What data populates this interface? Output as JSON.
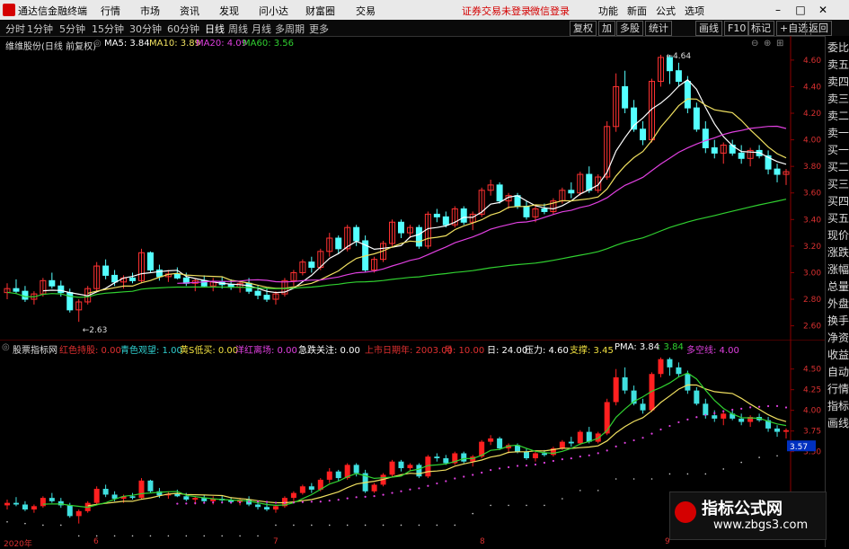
{
  "titlebar": {
    "app_name": "通达信金融终端",
    "menus": [
      "行情",
      "市场",
      "资讯",
      "发现",
      "问小达",
      "财富圈",
      "交易"
    ],
    "login_notice": "证券交易未登录",
    "login_link": "微信登录",
    "tools": [
      "功能",
      "新面",
      "公式",
      "选项"
    ]
  },
  "periods": [
    "分时",
    "1分钟",
    "5分钟",
    "15分钟",
    "30分钟",
    "60分钟",
    "日线",
    "周线",
    "月线",
    "多周期",
    "更多"
  ],
  "active_period": "日线",
  "toolbar_right": [
    "复权",
    "加",
    "多股",
    "统计",
    "画线",
    "F10",
    "标记",
    "+自选",
    "返回"
  ],
  "main_chart": {
    "title": "维维股份(日线 前复权)",
    "ma": [
      {
        "label": "MA5: 3.84",
        "color": "#ffffff"
      },
      {
        "label": "MA10: 3.89",
        "color": "#f0e060"
      },
      {
        "label": "MA20: 4.09",
        "color": "#e040e0"
      },
      {
        "label": "MA60: 3.56",
        "color": "#30d030"
      }
    ],
    "y_ticks": [
      "4.60",
      "4.40",
      "4.20",
      "4.00",
      "3.80",
      "3.60",
      "3.40",
      "3.20",
      "3.00",
      "2.80",
      "2.60"
    ],
    "annotations": {
      "high": "4.64",
      "low": "2.63"
    }
  },
  "lower_chart": {
    "title": "股票指标网",
    "items": [
      {
        "label": "红色持股: 0.00",
        "color": "#e03030"
      },
      {
        "label": "青色观望: 1.00",
        "color": "#30d0d0"
      },
      {
        "label": "黄S低买: 0.00",
        "color": "#f0e040"
      },
      {
        "label": "洋红离场: 0.00",
        "color": "#e040e0"
      },
      {
        "label": "急跌关注: 0.00",
        "color": "#ffffff"
      },
      {
        "label": "上市日期年: 2003.00",
        "color": "#e03030"
      },
      {
        "label": "月: 10.00",
        "color": "#e03030"
      },
      {
        "label": "日: 24.00",
        "color": "#ffffff"
      },
      {
        "label": "压力: 4.60",
        "color": "#ffffff"
      },
      {
        "label": "支撑: 3.45",
        "color": "#f0e040"
      },
      {
        "label": "PMA: 3.84",
        "color": "#ffffff"
      },
      {
        "label": ": 3.84",
        "color": "#30d030"
      },
      {
        "label": "多空线: 4.00",
        "color": "#e040e0"
      }
    ],
    "y_ticks": [
      "4.50",
      "4.25",
      "4.00",
      "3.75",
      "3.50"
    ],
    "current_value": "3.57"
  },
  "x_axis": [
    "2020年",
    "6",
    "7",
    "8",
    "9"
  ],
  "right_panel": [
    "委比",
    "卖五",
    "卖四",
    "卖三",
    "卖二",
    "卖一",
    "买一",
    "买二",
    "买三",
    "买四",
    "买五",
    "现价",
    "涨跌",
    "涨幅",
    "总量",
    "外盘",
    "换手",
    "净资",
    "收益",
    "自动",
    "行情",
    "指标",
    "画线"
  ],
  "watermark": {
    "title": "指标公式网",
    "url": "www.zbgs3.com"
  },
  "colors": {
    "up": "#ff3232",
    "down": "#54ffff",
    "ma5": "#ffffff",
    "ma10": "#f0e060",
    "ma20": "#e040e0",
    "ma60": "#30d030"
  },
  "candles": [
    [
      2.85,
      2.92,
      2.8,
      2.88
    ],
    [
      2.88,
      2.95,
      2.84,
      2.86
    ],
    [
      2.86,
      2.9,
      2.78,
      2.8
    ],
    [
      2.8,
      2.86,
      2.76,
      2.84
    ],
    [
      2.84,
      2.96,
      2.82,
      2.94
    ],
    [
      2.94,
      3.0,
      2.88,
      2.9
    ],
    [
      2.9,
      2.94,
      2.82,
      2.85
    ],
    [
      2.85,
      2.88,
      2.7,
      2.72
    ],
    [
      2.72,
      2.8,
      2.63,
      2.78
    ],
    [
      2.78,
      2.9,
      2.76,
      2.88
    ],
    [
      2.88,
      3.08,
      2.86,
      3.05
    ],
    [
      3.05,
      3.1,
      2.95,
      2.98
    ],
    [
      2.98,
      3.02,
      2.9,
      2.93
    ],
    [
      2.93,
      2.98,
      2.88,
      2.96
    ],
    [
      2.96,
      3.0,
      2.92,
      2.94
    ],
    [
      2.94,
      3.18,
      2.92,
      3.15
    ],
    [
      3.15,
      3.16,
      3.0,
      3.02
    ],
    [
      3.02,
      3.06,
      2.94,
      2.97
    ],
    [
      2.97,
      3.02,
      2.93,
      2.99
    ],
    [
      2.99,
      3.04,
      2.95,
      2.96
    ],
    [
      2.96,
      3.0,
      2.9,
      2.92
    ],
    [
      2.92,
      2.96,
      2.86,
      2.94
    ],
    [
      2.94,
      2.98,
      2.89,
      2.9
    ],
    [
      2.9,
      2.96,
      2.86,
      2.93
    ],
    [
      2.93,
      2.97,
      2.88,
      2.91
    ],
    [
      2.91,
      2.95,
      2.87,
      2.89
    ],
    [
      2.89,
      2.94,
      2.85,
      2.92
    ],
    [
      2.92,
      2.96,
      2.84,
      2.86
    ],
    [
      2.86,
      2.9,
      2.8,
      2.83
    ],
    [
      2.83,
      2.88,
      2.78,
      2.8
    ],
    [
      2.8,
      2.86,
      2.76,
      2.84
    ],
    [
      2.84,
      2.96,
      2.82,
      2.94
    ],
    [
      2.94,
      3.02,
      2.9,
      3.0
    ],
    [
      3.0,
      3.1,
      2.98,
      3.08
    ],
    [
      3.08,
      3.12,
      3.0,
      3.04
    ],
    [
      3.04,
      3.18,
      3.02,
      3.16
    ],
    [
      3.16,
      3.3,
      3.12,
      3.26
    ],
    [
      3.26,
      3.28,
      3.14,
      3.18
    ],
    [
      3.18,
      3.36,
      3.16,
      3.34
    ],
    [
      3.34,
      3.36,
      3.2,
      3.24
    ],
    [
      3.24,
      3.28,
      3.0,
      3.02
    ],
    [
      3.02,
      3.12,
      3.0,
      3.1
    ],
    [
      3.1,
      3.24,
      3.08,
      3.22
    ],
    [
      3.22,
      3.4,
      3.2,
      3.38
    ],
    [
      3.38,
      3.4,
      3.26,
      3.3
    ],
    [
      3.3,
      3.36,
      3.26,
      3.34
    ],
    [
      3.34,
      3.36,
      3.18,
      3.2
    ],
    [
      3.2,
      3.46,
      3.18,
      3.44
    ],
    [
      3.44,
      3.48,
      3.38,
      3.42
    ],
    [
      3.42,
      3.46,
      3.34,
      3.36
    ],
    [
      3.36,
      3.5,
      3.34,
      3.48
    ],
    [
      3.48,
      3.5,
      3.36,
      3.38
    ],
    [
      3.38,
      3.46,
      3.32,
      3.44
    ],
    [
      3.44,
      3.64,
      3.42,
      3.62
    ],
    [
      3.62,
      3.7,
      3.58,
      3.66
    ],
    [
      3.66,
      3.68,
      3.52,
      3.54
    ],
    [
      3.54,
      3.6,
      3.48,
      3.58
    ],
    [
      3.58,
      3.6,
      3.48,
      3.5
    ],
    [
      3.5,
      3.54,
      3.4,
      3.42
    ],
    [
      3.42,
      3.5,
      3.38,
      3.48
    ],
    [
      3.48,
      3.52,
      3.44,
      3.46
    ],
    [
      3.46,
      3.56,
      3.44,
      3.54
    ],
    [
      3.54,
      3.64,
      3.52,
      3.62
    ],
    [
      3.62,
      3.68,
      3.56,
      3.6
    ],
    [
      3.6,
      3.76,
      3.58,
      3.74
    ],
    [
      3.74,
      3.8,
      3.6,
      3.62
    ],
    [
      3.62,
      3.74,
      3.6,
      3.72
    ],
    [
      3.72,
      4.14,
      3.7,
      4.1
    ],
    [
      4.1,
      4.5,
      4.06,
      4.4
    ],
    [
      4.4,
      4.52,
      4.2,
      4.24
    ],
    [
      4.24,
      4.3,
      4.06,
      4.08
    ],
    [
      4.08,
      4.14,
      3.96,
      4.0
    ],
    [
      4.0,
      4.46,
      3.98,
      4.44
    ],
    [
      4.44,
      4.64,
      4.4,
      4.62
    ],
    [
      4.62,
      4.64,
      4.42,
      4.52
    ],
    [
      4.52,
      4.58,
      4.4,
      4.44
    ],
    [
      4.44,
      4.48,
      4.2,
      4.24
    ],
    [
      4.24,
      4.28,
      4.06,
      4.08
    ],
    [
      4.08,
      4.14,
      3.9,
      3.94
    ],
    [
      3.94,
      4.0,
      3.86,
      3.9
    ],
    [
      3.9,
      3.98,
      3.82,
      3.96
    ],
    [
      3.96,
      4.0,
      3.88,
      3.9
    ],
    [
      3.9,
      3.96,
      3.82,
      3.86
    ],
    [
      3.86,
      3.94,
      3.8,
      3.92
    ],
    [
      3.92,
      3.96,
      3.86,
      3.88
    ],
    [
      3.88,
      3.92,
      3.74,
      3.78
    ],
    [
      3.78,
      3.82,
      3.68,
      3.74
    ],
    [
      3.74,
      3.78,
      3.66,
      3.76
    ]
  ]
}
